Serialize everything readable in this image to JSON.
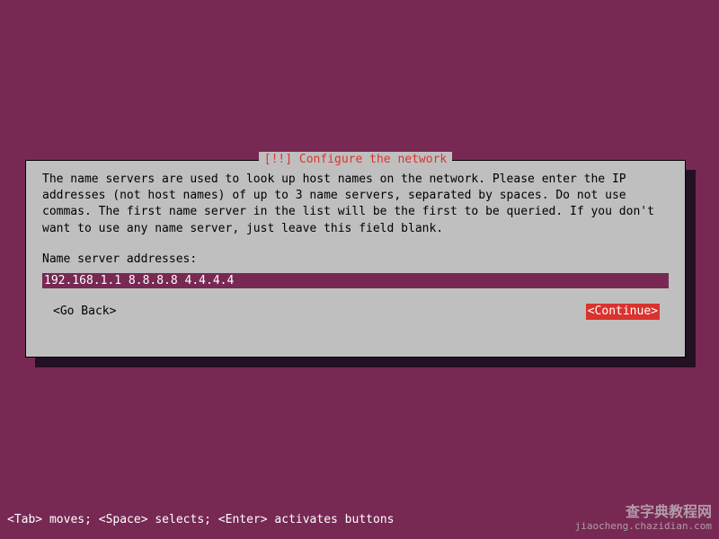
{
  "dialog": {
    "title": "[!!] Configure the network",
    "description": "The name servers are used to look up host names on the network. Please enter the IP addresses (not host names) of up to 3 name servers, separated by spaces. Do not use commas. The first name server in the list will be the first to be queried. If you don't want to use any name server, just leave this field blank.",
    "field_label": "Name server addresses:",
    "field_value": "192.168.1.1 8.8.8.8 4.4.4.4",
    "go_back_label": "<Go Back>",
    "continue_label": "<Continue>"
  },
  "status_bar": "<Tab> moves; <Space> selects; <Enter> activates buttons",
  "watermark": {
    "line1": "查字典教程网",
    "line2": "jiaocheng.chazidian.com"
  }
}
